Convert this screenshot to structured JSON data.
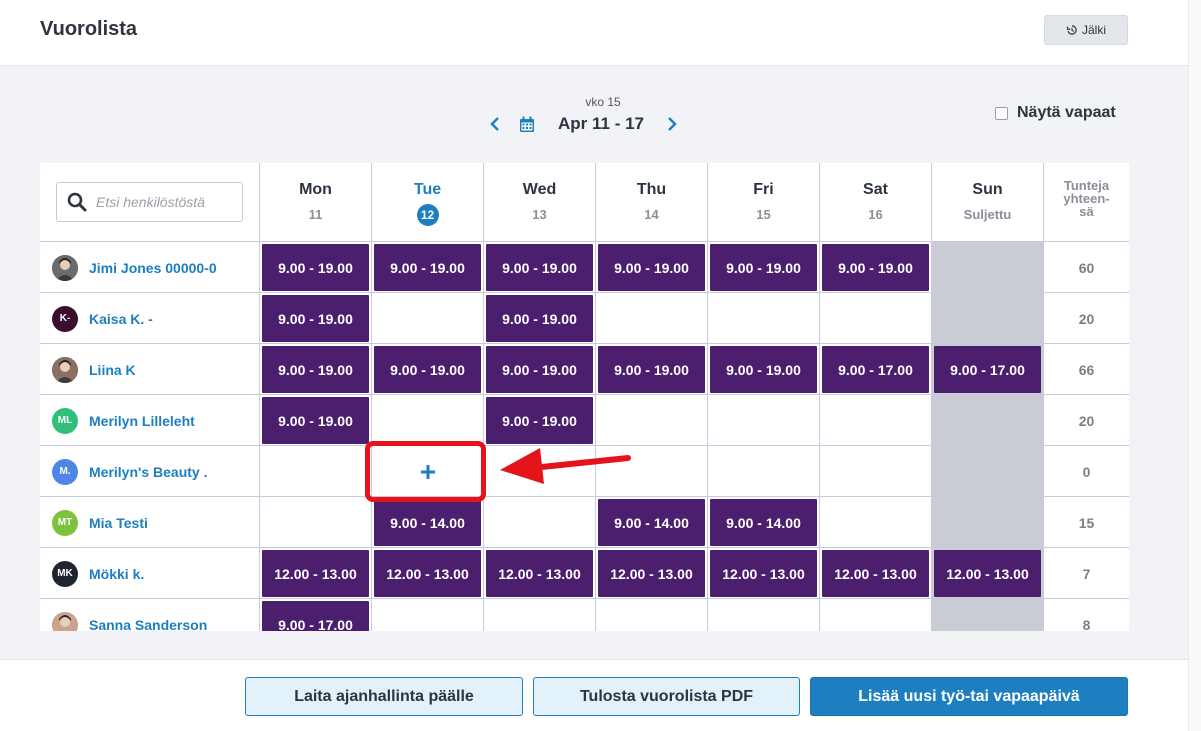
{
  "header": {
    "title": "Vuorolista",
    "history_label": "Jälki"
  },
  "week_nav": {
    "week_label": "vko 15",
    "date_range": "Apr 11 - 17"
  },
  "show_free": {
    "label": "Näytä vapaat",
    "checked": false
  },
  "search": {
    "placeholder": "Etsi henkilöstöstä"
  },
  "days": [
    {
      "name": "Mon",
      "sub": "11",
      "today": false,
      "closed": false
    },
    {
      "name": "Tue",
      "sub": "12",
      "today": true,
      "closed": false
    },
    {
      "name": "Wed",
      "sub": "13",
      "today": false,
      "closed": false
    },
    {
      "name": "Thu",
      "sub": "14",
      "today": false,
      "closed": false
    },
    {
      "name": "Fri",
      "sub": "15",
      "today": false,
      "closed": false
    },
    {
      "name": "Sat",
      "sub": "16",
      "today": false,
      "closed": false
    },
    {
      "name": "Sun",
      "sub": "Suljettu",
      "today": false,
      "closed": true
    }
  ],
  "total_header": [
    "Tunteja",
    "yhteen-",
    "sä"
  ],
  "staff": [
    {
      "name": "Jimi Jones 00000-0",
      "initials": "",
      "avatar_color": "#6b6b6b",
      "photo": true,
      "shifts": [
        "9.00 - 19.00",
        "9.00 - 19.00",
        "9.00 - 19.00",
        "9.00 - 19.00",
        "9.00 - 19.00",
        "9.00 - 19.00",
        ""
      ],
      "total": "60"
    },
    {
      "name": "Kaisa K. -",
      "initials": "K-",
      "avatar_color": "#3a0e2e",
      "photo": false,
      "shifts": [
        "9.00 - 19.00",
        "",
        "9.00 - 19.00",
        "",
        "",
        "",
        ""
      ],
      "total": "20"
    },
    {
      "name": "Liina K",
      "initials": "",
      "avatar_color": "#8b6f63",
      "photo": true,
      "shifts": [
        "9.00 - 19.00",
        "9.00 - 19.00",
        "9.00 - 19.00",
        "9.00 - 19.00",
        "9.00 - 19.00",
        "9.00 - 17.00",
        "9.00 - 17.00"
      ],
      "total": "66"
    },
    {
      "name": "Merilyn Lilleleht",
      "initials": "ML",
      "avatar_color": "#2fbf7a",
      "photo": false,
      "shifts": [
        "9.00 - 19.00",
        "",
        "9.00 - 19.00",
        "",
        "",
        "",
        ""
      ],
      "total": "20"
    },
    {
      "name": "Merilyn's Beauty .",
      "initials": "M.",
      "avatar_color": "#4f86e3",
      "photo": false,
      "shifts": [
        "",
        "+",
        "",
        "",
        "",
        "",
        ""
      ],
      "total": "0"
    },
    {
      "name": "Mia Testi",
      "initials": "MT",
      "avatar_color": "#7cc23a",
      "photo": false,
      "shifts": [
        "",
        "9.00 - 14.00",
        "",
        "9.00 - 14.00",
        "9.00 - 14.00",
        "",
        ""
      ],
      "total": "15"
    },
    {
      "name": "Mökki k.",
      "initials": "MK",
      "avatar_color": "#1f2530",
      "photo": false,
      "shifts": [
        "12.00 - 13.00",
        "12.00 - 13.00",
        "12.00 - 13.00",
        "12.00 - 13.00",
        "12.00 - 13.00",
        "12.00 - 13.00",
        "12.00 - 13.00"
      ],
      "total": "7"
    },
    {
      "name": "Sanna Sanderson",
      "initials": "",
      "avatar_color": "#c9a58f",
      "photo": true,
      "shifts": [
        "9.00 - 17.00",
        "",
        "",
        "",
        "",
        "",
        ""
      ],
      "total": "8"
    }
  ],
  "footer": {
    "time_tracking_label": "Laita ajanhallinta päälle",
    "print_pdf_label": "Tulosta vuorolista PDF",
    "add_day_label": "Lisää uusi työ-tai vapaapäivä"
  },
  "colors": {
    "shift_bg": "#4b1f6e",
    "accent": "#1e7fc0",
    "closed_bg": "#c9ccd4",
    "annotation": "#e5141b"
  },
  "icons": {
    "history": "history-icon",
    "prev": "chevron-left-icon",
    "calendar": "calendar-icon",
    "next": "chevron-right-icon",
    "search": "search-icon",
    "add": "plus-icon"
  }
}
